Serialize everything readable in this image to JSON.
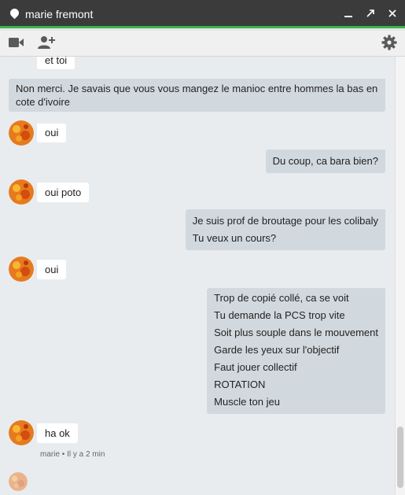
{
  "window": {
    "title": "marie fremont",
    "minimize_icon": "minimize-icon",
    "popout_icon": "popout-icon",
    "close_icon": "close-icon"
  },
  "toolbar": {
    "video_icon": "video-call-icon",
    "add_person_icon": "add-person-icon",
    "settings_icon": "gear-icon"
  },
  "messages": [
    {
      "from": "them",
      "lines": [
        "et toi"
      ]
    },
    {
      "from": "me",
      "lines": [
        "Non merci. Je savais que vous vous mangez le manioc entre hommes la bas en cote d'ivoire"
      ]
    },
    {
      "from": "them",
      "lines": [
        "oui"
      ]
    },
    {
      "from": "me",
      "lines": [
        "Du coup, ca bara bien?"
      ]
    },
    {
      "from": "them",
      "lines": [
        "oui poto"
      ]
    },
    {
      "from": "me",
      "lines": [
        "Je suis prof de broutage pour les colibaly",
        "Tu veux un cours?"
      ]
    },
    {
      "from": "them",
      "lines": [
        "oui"
      ]
    },
    {
      "from": "me",
      "lines": [
        "Trop de copié collé, ca se voit",
        "Tu demande la PCS trop vite",
        "Soit plus souple dans le mouvement",
        "Garde les yeux sur l'objectif",
        "Faut jouer collectif",
        "ROTATION",
        "Muscle ton jeu"
      ]
    },
    {
      "from": "them",
      "lines": [
        "ha ok"
      ]
    }
  ],
  "last_meta": "marie • Il y a 2 min",
  "colors": {
    "titlebar": "#3b3b3b",
    "accent": "#3bb34a",
    "outgoing_bubble": "#d2d9de",
    "incoming_bubble": "#ffffff",
    "chat_bg": "#e9ecee"
  }
}
